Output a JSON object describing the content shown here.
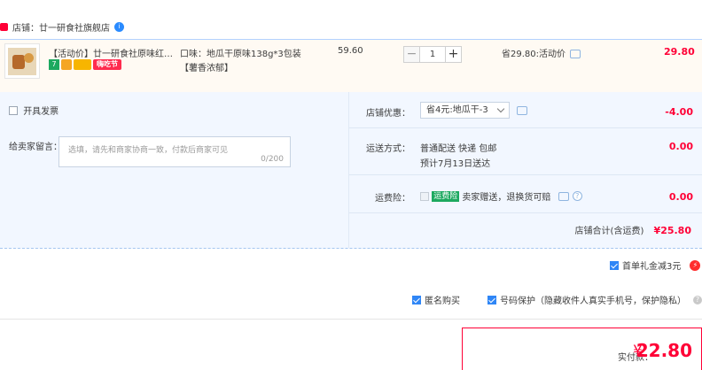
{
  "shop": {
    "label": "店铺：廿一研食社旗舰店",
    "ww_badge": "i"
  },
  "item": {
    "title": "【活动价】廿一研食社原味红薯…",
    "badges": [
      "7",
      "",
      "",
      "嗨吃节"
    ],
    "sku_line1": "口味：地瓜干原味138g*3包装",
    "sku_line2": "【薯香浓郁】",
    "price": "59.60",
    "qty": "1",
    "qty_minus": "−",
    "qty_plus": "+",
    "promo": "省29.80:活动价",
    "subtotal": "29.80"
  },
  "options": {
    "invoice_label": "开具发票",
    "memo_label": "给卖家留言：",
    "memo_placeholder": "选填，请先和商家协商一致，付款后商家可见",
    "memo_counter": "0/200",
    "discount_label": "店铺优惠：",
    "discount_value": "省4元:地瓜干-3",
    "discount_amount": "-4.00",
    "shipping_label": "运送方式：",
    "shipping_value": "普通配送 快递 包邮",
    "shipping_eta": "预计7月13日送达",
    "shipping_amount": "0.00",
    "insurance_label": "运费险：",
    "insurance_tag": "运费险",
    "insurance_text": "卖家赠送，退换货可赔",
    "insurance_amount": "0.00",
    "store_total_label": "店铺合计(含运费)",
    "store_total_value": "¥25.80"
  },
  "gift": {
    "label": "首单礼金减3元",
    "bolt": "⚡"
  },
  "bottom": {
    "anon_label": "匿名购买",
    "privacy_label": "号码保护（隐藏收件人真实手机号，保护隐私）",
    "help_icon": "?"
  },
  "pay": {
    "label": "实付款：",
    "currency": "¥",
    "amount": "22.80"
  },
  "colors": {
    "accent": "#ff0036",
    "checkbox": "#2f86f6",
    "panel": "#f2f7ff"
  }
}
